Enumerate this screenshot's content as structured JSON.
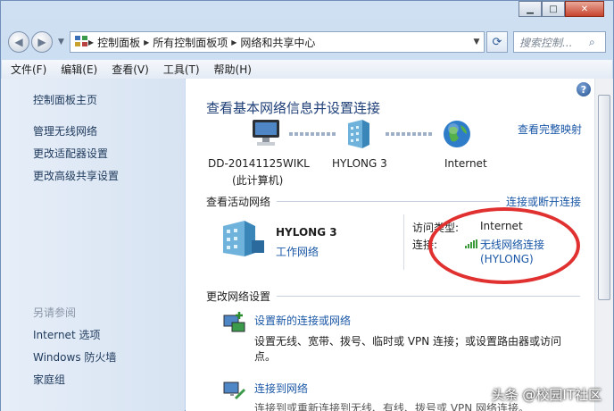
{
  "window": {
    "minimize": "▁",
    "maximize": "□",
    "close": "✕"
  },
  "address": {
    "crumbs": [
      "控制面板",
      "所有控制面板项",
      "网络和共享中心"
    ],
    "search_placeholder": "搜索控制..."
  },
  "menu": [
    "文件(F)",
    "编辑(E)",
    "查看(V)",
    "工具(T)",
    "帮助(H)"
  ],
  "sidebar": {
    "links": [
      "控制面板主页",
      "管理无线网络",
      "更改适配器设置",
      "更改高级共享设置"
    ],
    "see_also_header": "另请参阅",
    "see_also": [
      "Internet 选项",
      "Windows 防火墙",
      "家庭组"
    ]
  },
  "main": {
    "title": "查看基本网络信息并设置连接",
    "full_map_link": "查看完整映射",
    "computer_name": "DD-20141125WIKL",
    "computer_sub": "(此计算机)",
    "network_name": "HYLONG  3",
    "internet_label": "Internet",
    "active_header": "查看活动网络",
    "connect_link": "连接或断开连接",
    "active_network": "HYLONG  3",
    "network_type": "工作网络",
    "access_label": "访问类型:",
    "access_value": "Internet",
    "conn_label": "连接:",
    "conn_value": "无线网络连接",
    "conn_ssid": "(HYLONG)",
    "change_header": "更改网络设置",
    "task1_title": "设置新的连接或网络",
    "task1_desc": "设置无线、宽带、拨号、临时或 VPN 连接；或设置路由器或访问",
    "task1_desc2": "点。",
    "task2_title": "连接到网络",
    "task2_desc": "连接到或重新连接到无线、有线、拨号或 VPN 网络连接。"
  },
  "watermark": "头条 @校园IT社区"
}
